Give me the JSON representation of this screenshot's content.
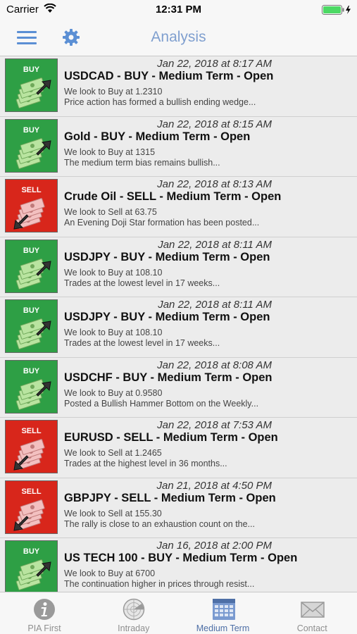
{
  "status": {
    "carrier": "Carrier",
    "time": "12:31 PM"
  },
  "nav": {
    "title": "Analysis"
  },
  "colors": {
    "buy": "#2e9f45",
    "sell": "#d8261b",
    "accent": "#5b8fd4"
  },
  "items": [
    {
      "signal": "BUY",
      "date": "Jan 22, 2018 at 8:17 AM",
      "title": "USDCAD - BUY - Medium Term - Open",
      "line1": "We look to Buy at 1.2310",
      "line2": "Price action has formed a bullish ending wedge..."
    },
    {
      "signal": "BUY",
      "date": "Jan 22, 2018 at 8:15 AM",
      "title": "Gold - BUY - Medium Term - Open",
      "line1": "We look to Buy at 1315",
      "line2": "The medium term bias remains bullish..."
    },
    {
      "signal": "SELL",
      "date": "Jan 22, 2018 at 8:13 AM",
      "title": "Crude Oil  - SELL - Medium Term - Open",
      "line1": "We look to Sell at 63.75",
      "line2": "An Evening Doji Star formation has been posted..."
    },
    {
      "signal": "BUY",
      "date": "Jan 22, 2018 at 8:11 AM",
      "title": "USDJPY - BUY - Medium Term - Open",
      "line1": "We look to Buy at 108.10",
      "line2": "Trades at the lowest level in 17 weeks..."
    },
    {
      "signal": "BUY",
      "date": "Jan 22, 2018 at 8:11 AM",
      "title": "USDJPY - BUY - Medium Term - Open",
      "line1": "We look to Buy at 108.10",
      "line2": "Trades at the lowest level in 17 weeks..."
    },
    {
      "signal": "BUY",
      "date": "Jan 22, 2018 at 8:08 AM",
      "title": "USDCHF - BUY - Medium Term - Open",
      "line1": "We look to Buy at 0.9580",
      "line2": "Posted a Bullish Hammer Bottom on the Weekly..."
    },
    {
      "signal": "SELL",
      "date": "Jan 22, 2018 at 7:53 AM",
      "title": "EURUSD - SELL - Medium Term - Open",
      "line1": "We look to Sell at 1.2465",
      "line2": "Trades at the highest level in 36 months..."
    },
    {
      "signal": "SELL",
      "date": "Jan 21, 2018 at 4:50 PM",
      "title": "GBPJPY - SELL - Medium Term - Open",
      "line1": "We look to Sell at 155.30",
      "line2": "The rally is close to an exhaustion count on the..."
    },
    {
      "signal": "BUY",
      "date": "Jan 16, 2018 at 2:00 PM",
      "title": "US TECH 100 - BUY - Medium Term - Open",
      "line1": "We look to Buy at 6700",
      "line2": "The continuation higher in prices through resist..."
    }
  ],
  "tabs": [
    {
      "label": "PIA First",
      "icon": "info-icon",
      "active": false
    },
    {
      "label": "Intraday",
      "icon": "radar-icon",
      "active": false
    },
    {
      "label": "Medium Term",
      "icon": "calendar-icon",
      "active": true
    },
    {
      "label": "Contact",
      "icon": "envelope-icon",
      "active": false
    }
  ]
}
